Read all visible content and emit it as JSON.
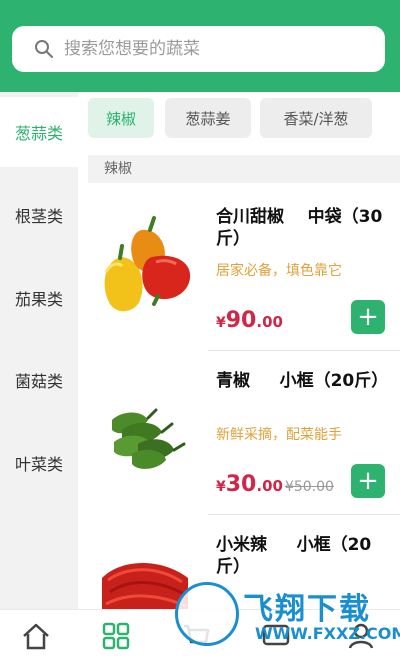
{
  "search": {
    "placeholder": "搜索您想要的蔬菜",
    "icon": "search-icon"
  },
  "sidebar": {
    "items": [
      {
        "label": "葱蒜类",
        "active": true
      },
      {
        "label": "根茎类",
        "active": false
      },
      {
        "label": "茄果类",
        "active": false
      },
      {
        "label": "菌菇类",
        "active": false
      },
      {
        "label": "叶菜类",
        "active": false
      }
    ]
  },
  "tabs": [
    {
      "label": "辣椒",
      "active": true
    },
    {
      "label": "葱蒜姜",
      "active": false
    },
    {
      "label": "香菜/洋葱",
      "active": false
    }
  ],
  "section": {
    "title": "辣椒"
  },
  "products": [
    {
      "name": "合川甜椒    中袋（30斤）",
      "desc": "居家必备，填色靠它",
      "price_currency": "¥",
      "price_int": "90",
      "price_dec": ".00",
      "old_price": ""
    },
    {
      "name": "青椒     小框（20斤）",
      "desc": "新鲜采摘，配菜能手",
      "price_currency": "¥",
      "price_int": "30",
      "price_dec": ".00",
      "old_price": "¥50.00"
    },
    {
      "name": "小米辣     小框（20斤）",
      "desc": "",
      "price_currency": "",
      "price_int": "",
      "price_dec": "",
      "old_price": ""
    }
  ],
  "add_button": {
    "label": "+"
  },
  "bottom_nav": {
    "icons": [
      "home-icon",
      "category-icon",
      "cart-icon",
      "message-icon",
      "profile-icon"
    ]
  },
  "watermark": {
    "title": "飞翔下载",
    "url": "WWW.FXXZ.COM"
  },
  "colors": {
    "brand": "#2db36f",
    "price": "#d0264a",
    "desc": "#e0a23a",
    "watermark": "#1a8fd0"
  }
}
